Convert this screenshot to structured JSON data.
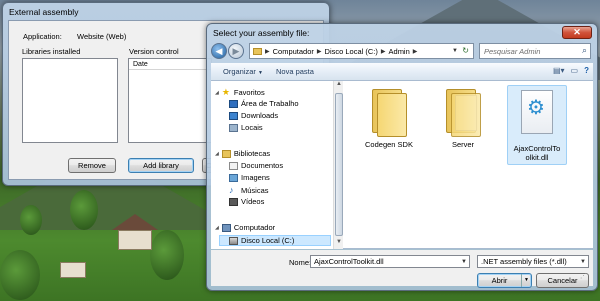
{
  "background_dialog": {
    "title": "External assembly",
    "application_label": "Application:",
    "application_value": "Website (Web)",
    "libraries_label": "Libraries installed",
    "version_label": "Version control",
    "date_column": "Date",
    "remove_button": "Remove",
    "add_library_button": "Add library",
    "truncated_button": "C"
  },
  "file_dialog": {
    "title": "Select your assembly file:",
    "close_symbol": "✕",
    "address": {
      "segments": [
        "Computador",
        "Disco Local (C:)",
        "Admin"
      ]
    },
    "search_placeholder": "Pesquisar Admin",
    "toolbar": {
      "organize": "Organizar",
      "new_folder": "Nova pasta"
    },
    "nav": {
      "favorites": "Favoritos",
      "desktop": "Área de Trabalho",
      "downloads": "Downloads",
      "places": "Locais",
      "libraries": "Bibliotecas",
      "documents": "Documentos",
      "images": "Imagens",
      "music": "Músicas",
      "videos": "Vídeos",
      "computer": "Computador",
      "local_disk": "Disco Local (C:)"
    },
    "files": [
      {
        "name": "Codegen SDK",
        "icon": "folder-icon"
      },
      {
        "name": "Server",
        "icon": "folder-with-documents-icon"
      },
      {
        "name": "AjaxControlToolkit.dll",
        "icon": "dll-file-icon"
      }
    ],
    "filename_label": "Nome:",
    "filename_value": "AjaxControlToolkit.dll",
    "filter_value": ".NET assembly files (*.dll)",
    "open_button": "Abrir",
    "cancel_button": "Cancelar"
  }
}
